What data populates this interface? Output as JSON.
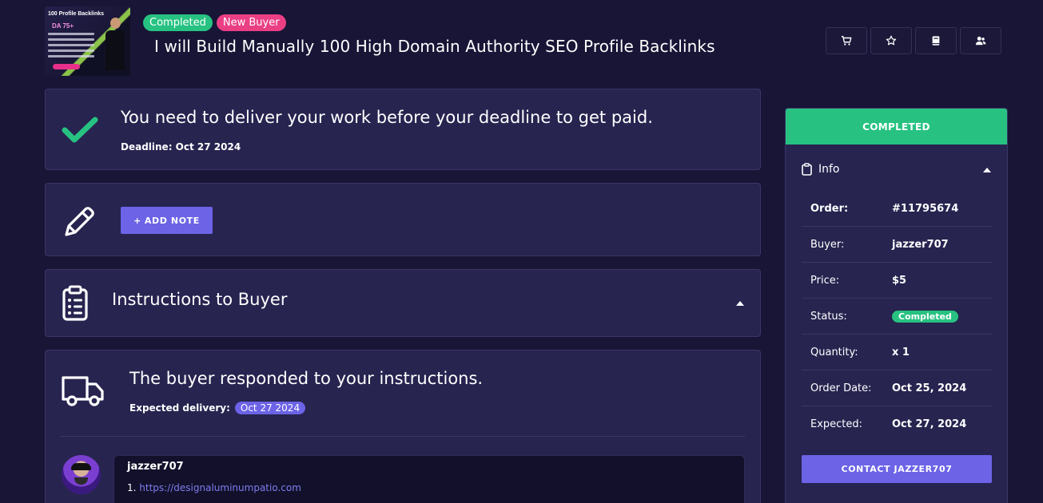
{
  "header": {
    "thumbnail": {
      "title": "100 Profile Backlinks",
      "subtitle": "DA 75+"
    },
    "badges": [
      "Completed",
      "New Buyer"
    ],
    "title": "I will Build Manually 100 High Domain Authority SEO Profile Backlinks",
    "icons": [
      "cart-icon",
      "star-icon",
      "book-icon",
      "users-icon"
    ]
  },
  "deadline_card": {
    "message": "You need to deliver your work before your deadline to get paid.",
    "deadline": "Deadline: Oct 27 2024"
  },
  "note_card": {
    "button_label": "ADD NOTE"
  },
  "instructions_card": {
    "heading": "Instructions to Buyer"
  },
  "response_card": {
    "message": "The buyer responded to your instructions.",
    "expected_label": "Expected delivery:",
    "expected_date": "Oct 27 2024",
    "message_user": "jazzer707",
    "message_line": "1.",
    "message_link": "https://designaluminumpatio.com"
  },
  "sidebar": {
    "status": "COMPLETED",
    "info_title": "Info",
    "rows": [
      {
        "label": "Order:",
        "value": "#11795674"
      },
      {
        "label": "Buyer:",
        "value": "jazzer707"
      },
      {
        "label": "Price:",
        "value": "$5"
      },
      {
        "label": "Status:",
        "value": "Completed"
      },
      {
        "label": "Quantity:",
        "value": "x 1"
      },
      {
        "label": "Order Date:",
        "value": "Oct 25, 2024"
      },
      {
        "label": "Expected:",
        "value": "Oct 27, 2024"
      }
    ],
    "contact_label": "CONTACT JAZZER707"
  },
  "colors": {
    "background": "#181536",
    "card": "#272450",
    "green": "#27c281",
    "pink": "#ea3f84",
    "accent": "#6c63e6"
  }
}
